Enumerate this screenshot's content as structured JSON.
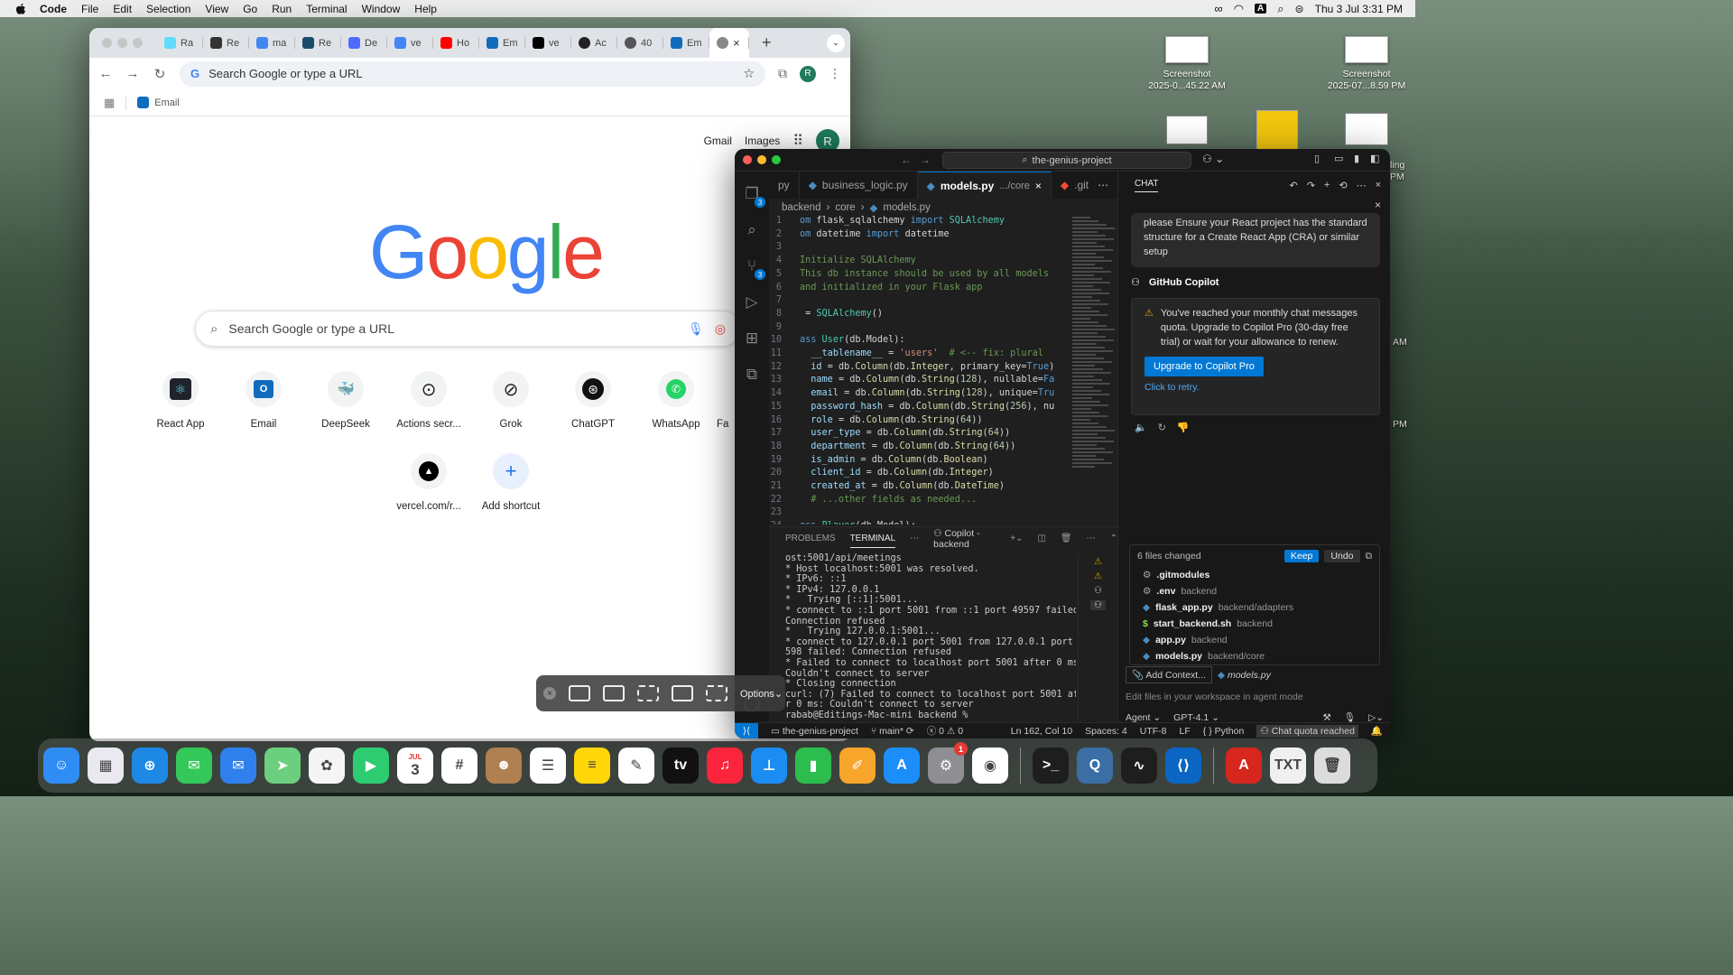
{
  "menubar": {
    "items": [
      "Code",
      "File",
      "Edit",
      "Selection",
      "View",
      "Go",
      "Run",
      "Terminal",
      "Window",
      "Help"
    ],
    "clock": "Thu 3 Jul  3:31 PM",
    "input_source": "A"
  },
  "desktop": {
    "icons": [
      {
        "name": "Screenshot",
        "sub": "2025-0...45.22 AM"
      },
      {
        "name": "Screenshot",
        "sub": "2025-07...8.59 PM"
      }
    ],
    "peek_labels": [
      "ling",
      "PM",
      "AM",
      "PM"
    ]
  },
  "chrome": {
    "tabs": [
      "Ra",
      "Re",
      "ma",
      "Re",
      "De",
      "ve",
      "Ho",
      "Em",
      "ve",
      "Ac",
      "40",
      "Em",
      ""
    ],
    "omnibox_placeholder": "Search Google or type a URL",
    "bookmark": "Email",
    "links": {
      "gmail": "Gmail",
      "images": "Images",
      "avatar": "R"
    },
    "search_placeholder": "Search Google or type a URL",
    "shortcuts": [
      {
        "label": "React App",
        "icon": "⚛",
        "color": "#61dafb"
      },
      {
        "label": "Email",
        "icon": "O",
        "color": "#0f6cbd"
      },
      {
        "label": "DeepSeek",
        "icon": "🐳",
        "color": "#4d6bfe"
      },
      {
        "label": "Actions secr...",
        "icon": "⊙",
        "color": "#222222"
      },
      {
        "label": "Grok",
        "icon": "⊘",
        "color": "#222222"
      },
      {
        "label": "ChatGPT",
        "icon": "⊛",
        "color": "#111111"
      },
      {
        "label": "WhatsApp",
        "icon": "✆",
        "color": "#25d366"
      },
      {
        "label": "Fa",
        "icon": "",
        "color": "#888888"
      },
      {
        "label": "vercel.com/r...",
        "icon": "▲",
        "color": "#000000"
      },
      {
        "label": "Add shortcut",
        "icon": "+",
        "color": "#1a73e8"
      }
    ]
  },
  "vscode": {
    "search": "the-genius-project",
    "tabs": [
      {
        "label": "py",
        "active": false
      },
      {
        "label": "business_logic.py",
        "active": false
      },
      {
        "label": "models.py",
        "sub": ".../core",
        "active": true
      },
      {
        "label": ".git",
        "active": false
      }
    ],
    "breadcrumb": [
      "backend",
      "core",
      "models.py"
    ],
    "activity_badges": {
      "explorer": "3",
      "scm": "3"
    },
    "code_lines": [
      {
        "n": "1",
        "t": "om flask_sqlalchemy import SQLAlchemy"
      },
      {
        "n": "2",
        "t": "om datetime import datetime"
      },
      {
        "n": "3",
        "t": ""
      },
      {
        "n": "4",
        "t": "Initialize SQLAlchemy"
      },
      {
        "n": "5",
        "t": "This db instance should be used by all models"
      },
      {
        "n": "6",
        "t": "and initialized in your Flask app"
      },
      {
        "n": "7",
        "t": ""
      },
      {
        "n": "8",
        "t": " = SQLAlchemy()"
      },
      {
        "n": "9",
        "t": ""
      },
      {
        "n": "10",
        "t": "ass User(db.Model):"
      },
      {
        "n": "11",
        "t": "  __tablename__ = 'users'  # <-- fix: plural"
      },
      {
        "n": "12",
        "t": "  id = db.Column(db.Integer, primary_key=True)"
      },
      {
        "n": "13",
        "t": "  name = db.Column(db.String(128), nullable=Fa"
      },
      {
        "n": "14",
        "t": "  email = db.Column(db.String(128), unique=Tru"
      },
      {
        "n": "15",
        "t": "  password_hash = db.Column(db.String(256), nu"
      },
      {
        "n": "16",
        "t": "  role = db.Column(db.String(64))"
      },
      {
        "n": "17",
        "t": "  user_type = db.Column(db.String(64))"
      },
      {
        "n": "18",
        "t": "  department = db.Column(db.String(64))"
      },
      {
        "n": "19",
        "t": "  is_admin = db.Column(db.Boolean)"
      },
      {
        "n": "20",
        "t": "  client_id = db.Column(db.Integer)"
      },
      {
        "n": "21",
        "t": "  created_at = db.Column(db.DateTime)"
      },
      {
        "n": "22",
        "t": "  # ...other fields as needed..."
      },
      {
        "n": "23",
        "t": ""
      },
      {
        "n": "24",
        "t": "ass Player(db.Model):"
      }
    ],
    "panel": {
      "problems": "PROBLEMS",
      "terminal": "TERMINAL",
      "terminal_name": "Copilot - backend"
    },
    "terminal_lines": [
      "ost:5001/api/meetings",
      "* Host localhost:5001 was resolved.",
      "* IPv6: ::1",
      "* IPv4: 127.0.0.1",
      "*   Trying [::1]:5001...",
      "* connect to ::1 port 5001 from ::1 port 49597 failed:",
      "Connection refused",
      "*   Trying 127.0.0.1:5001...",
      "* connect to 127.0.0.1 port 5001 from 127.0.0.1 port 49",
      "598 failed: Connection refused",
      "* Failed to connect to localhost port 5001 after 0 ms:",
      "Couldn't connect to server",
      "* Closing connection",
      "curl: (7) Failed to connect to localhost port 5001 afte",
      "r 0 ms: Couldn't connect to server",
      "rabab@Editings-Mac-mini backend % "
    ],
    "status": {
      "project": "the-genius-project",
      "branch": "main*",
      "problems": "0",
      "warnings": "0",
      "position": "Ln 162, Col 10",
      "spaces": "Spaces: 4",
      "encoding": "UTF-8",
      "eol": "LF",
      "language": "Python",
      "copilot": "Chat quota reached"
    },
    "chat": {
      "title": "CHAT",
      "user_message": "please Ensure your React project has the standard structure for a Create React App (CRA) or similar setup",
      "assistant": "GitHub Copilot",
      "quota_message": "You've reached your monthly chat messages quota. Upgrade to Copilot Pro (30-day free trial) or wait for your allowance to renew.",
      "upgrade": "Upgrade to Copilot Pro",
      "retry": "Click to retry.",
      "changes_title": "6 files changed",
      "keep": "Keep",
      "undo": "Undo",
      "files": [
        {
          "name": ".gitmodules",
          "dir": ""
        },
        {
          "name": ".env",
          "dir": "backend"
        },
        {
          "name": "flask_app.py",
          "dir": "backend/adapters"
        },
        {
          "name": "start_backend.sh",
          "dir": "backend"
        },
        {
          "name": "app.py",
          "dir": "backend"
        },
        {
          "name": "models.py",
          "dir": "backend/core"
        }
      ],
      "add_context": "Add Context...",
      "context_file": "models.py",
      "input_placeholder": "Edit files in your workspace in agent mode",
      "mode": "Agent",
      "model": "GPT-4.1"
    }
  },
  "capture": {
    "options": "Options"
  },
  "dock": {
    "apps": [
      {
        "name": "Finder",
        "color": "#2f8cf3",
        "glyph": "☺"
      },
      {
        "name": "Launchpad",
        "color": "#e9e9ef",
        "glyph": "▦"
      },
      {
        "name": "Safari",
        "color": "#1e88e5",
        "glyph": "⊕"
      },
      {
        "name": "Messages",
        "color": "#34c759",
        "glyph": "✉"
      },
      {
        "name": "Mail",
        "color": "#2f80ed",
        "glyph": "✉"
      },
      {
        "name": "Maps",
        "color": "#6bcf7f",
        "glyph": "➤"
      },
      {
        "name": "Photos",
        "color": "#f5f5f5",
        "glyph": "✿"
      },
      {
        "name": "FaceTime",
        "color": "#2ecc71",
        "glyph": "▶"
      },
      {
        "name": "Calendar",
        "color": "#ffffff",
        "glyph": "3",
        "month": "JUL"
      },
      {
        "name": "Slack",
        "color": "#ffffff",
        "glyph": "#"
      },
      {
        "name": "Contacts",
        "color": "#b08050",
        "glyph": "☻"
      },
      {
        "name": "Reminders",
        "color": "#ffffff",
        "glyph": "☰"
      },
      {
        "name": "Notes",
        "color": "#ffd60a",
        "glyph": "≡"
      },
      {
        "name": "Freeform",
        "color": "#ffffff",
        "glyph": "✎"
      },
      {
        "name": "TV",
        "color": "#111111",
        "glyph": "tv"
      },
      {
        "name": "Music",
        "color": "#fa243c",
        "glyph": "♫"
      },
      {
        "name": "Keynote",
        "color": "#1b8cf2",
        "glyph": "⊥"
      },
      {
        "name": "Numbers",
        "color": "#2dbd4e",
        "glyph": "▮"
      },
      {
        "name": "Pages",
        "color": "#f7a52b",
        "glyph": "✐"
      },
      {
        "name": "App Store",
        "color": "#1c8ef9",
        "glyph": "A"
      },
      {
        "name": "System Settings",
        "color": "#8e8e93",
        "glyph": "⚙",
        "badge": "1"
      },
      {
        "name": "Chrome",
        "color": "#ffffff",
        "glyph": "◉"
      },
      {
        "name": "Terminal",
        "color": "#1e1e1e",
        "glyph": ">_"
      },
      {
        "name": "QuickTime",
        "color": "#3a6ea5",
        "glyph": "Q"
      },
      {
        "name": "Activity Monitor",
        "color": "#1e1e1e",
        "glyph": "∿"
      },
      {
        "name": "VS Code",
        "color": "#0a66c2",
        "glyph": "⟨⟩"
      },
      {
        "name": "Acrobat",
        "color": "#d7261e",
        "glyph": "A"
      },
      {
        "name": "Documents",
        "color": "#f0f0f0",
        "glyph": "TXT"
      },
      {
        "name": "Trash",
        "color": "#dcdcdc",
        "glyph": "🗑"
      }
    ]
  }
}
